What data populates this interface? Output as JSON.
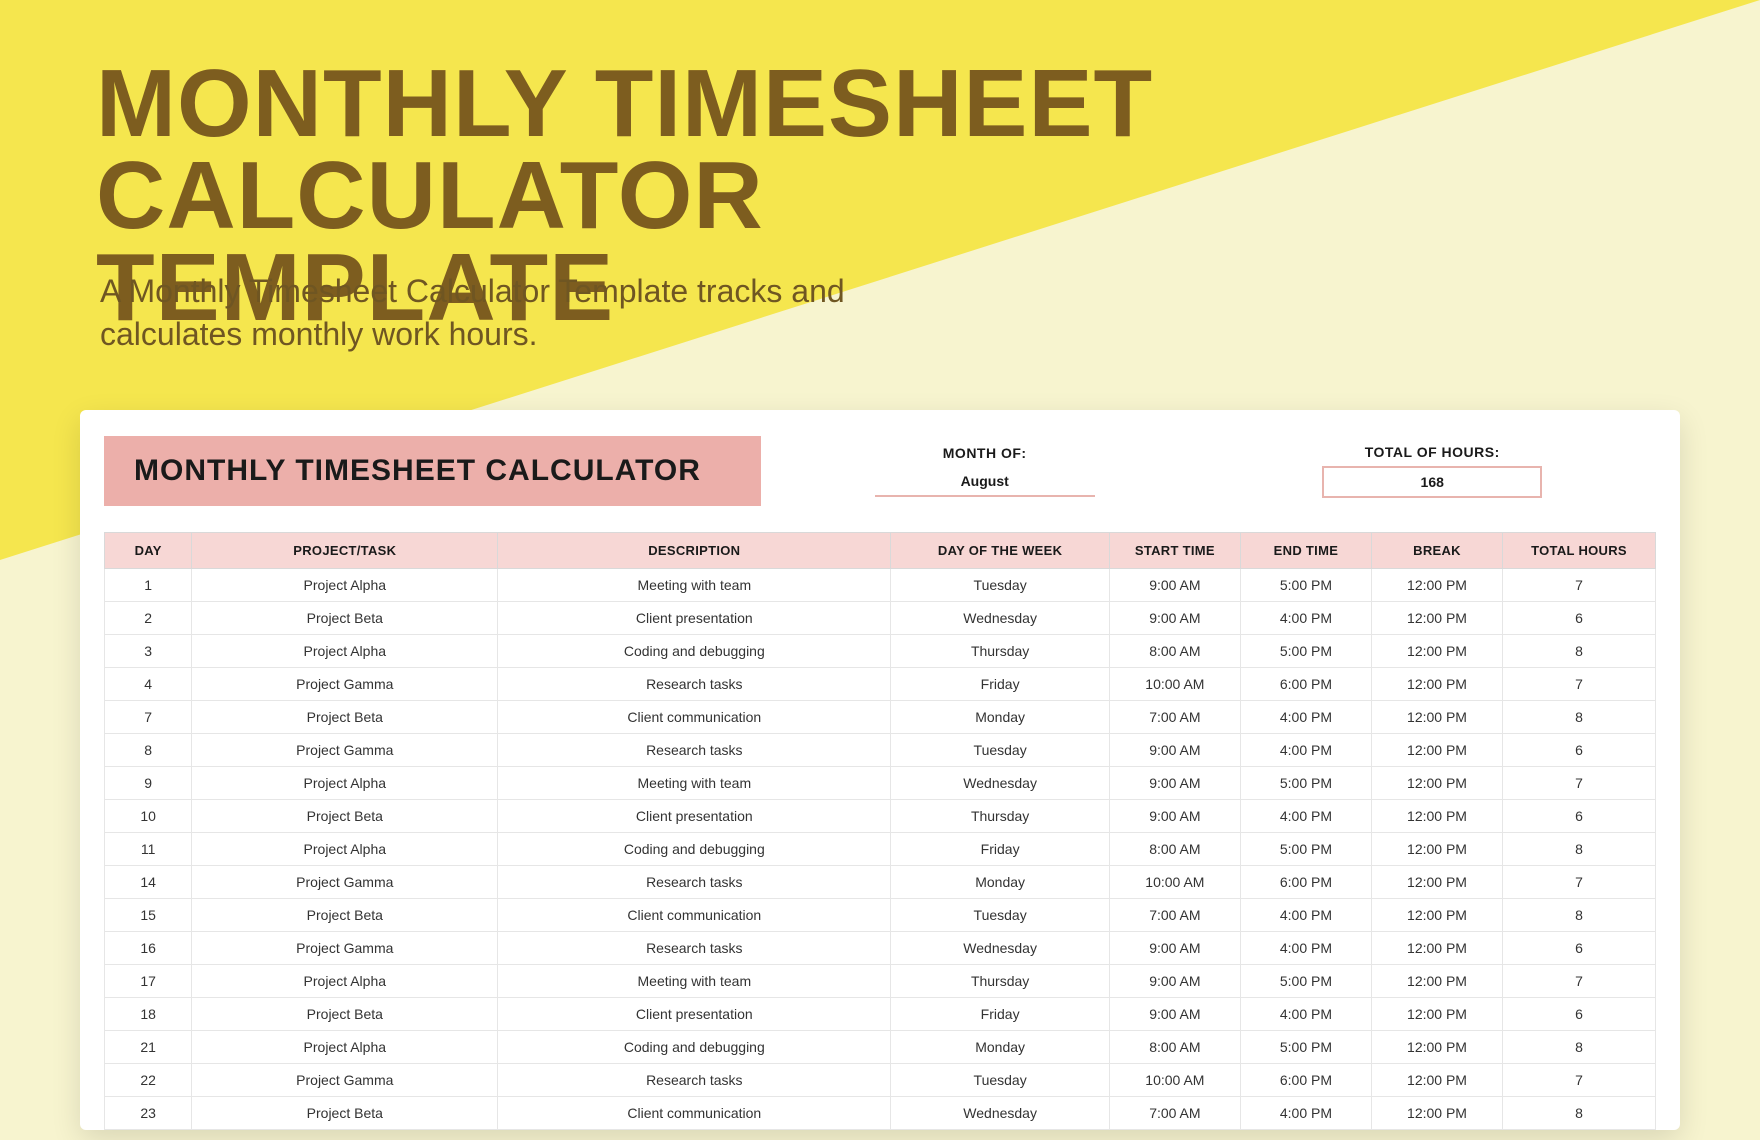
{
  "hero": {
    "title_line1": "MONTHLY TIMESHEET",
    "title_line2": "CALCULATOR TEMPLATE",
    "subtitle": "A Monthly Timesheet Calculator Template tracks and calculates monthly work hours."
  },
  "sheet": {
    "title": "MONTHLY TIMESHEET CALCULATOR",
    "month_label": "MONTH OF:",
    "month_value": "August",
    "total_label": "TOTAL OF HOURS:",
    "total_value": "168"
  },
  "columns": {
    "day": "DAY",
    "project": "PROJECT/TASK",
    "description": "DESCRIPTION",
    "dow": "DAY OF THE WEEK",
    "start": "START TIME",
    "end": "END TIME",
    "break": "BREAK",
    "total": "TOTAL HOURS"
  },
  "rows": [
    {
      "day": "1",
      "project": "Project Alpha",
      "description": "Meeting with team",
      "dow": "Tuesday",
      "start": "9:00 AM",
      "end": "5:00 PM",
      "break": "12:00 PM",
      "total": "7"
    },
    {
      "day": "2",
      "project": "Project Beta",
      "description": "Client presentation",
      "dow": "Wednesday",
      "start": "9:00 AM",
      "end": "4:00 PM",
      "break": "12:00 PM",
      "total": "6"
    },
    {
      "day": "3",
      "project": "Project Alpha",
      "description": "Coding and debugging",
      "dow": "Thursday",
      "start": "8:00 AM",
      "end": "5:00 PM",
      "break": "12:00 PM",
      "total": "8"
    },
    {
      "day": "4",
      "project": "Project Gamma",
      "description": "Research tasks",
      "dow": "Friday",
      "start": "10:00 AM",
      "end": "6:00 PM",
      "break": "12:00 PM",
      "total": "7"
    },
    {
      "day": "7",
      "project": "Project Beta",
      "description": "Client communication",
      "dow": "Monday",
      "start": "7:00 AM",
      "end": "4:00 PM",
      "break": "12:00 PM",
      "total": "8"
    },
    {
      "day": "8",
      "project": "Project Gamma",
      "description": "Research tasks",
      "dow": "Tuesday",
      "start": "9:00 AM",
      "end": "4:00 PM",
      "break": "12:00 PM",
      "total": "6"
    },
    {
      "day": "9",
      "project": "Project Alpha",
      "description": "Meeting with team",
      "dow": "Wednesday",
      "start": "9:00 AM",
      "end": "5:00 PM",
      "break": "12:00 PM",
      "total": "7"
    },
    {
      "day": "10",
      "project": "Project Beta",
      "description": "Client presentation",
      "dow": "Thursday",
      "start": "9:00 AM",
      "end": "4:00 PM",
      "break": "12:00 PM",
      "total": "6"
    },
    {
      "day": "11",
      "project": "Project Alpha",
      "description": "Coding and debugging",
      "dow": "Friday",
      "start": "8:00 AM",
      "end": "5:00 PM",
      "break": "12:00 PM",
      "total": "8"
    },
    {
      "day": "14",
      "project": "Project Gamma",
      "description": "Research tasks",
      "dow": "Monday",
      "start": "10:00 AM",
      "end": "6:00 PM",
      "break": "12:00 PM",
      "total": "7"
    },
    {
      "day": "15",
      "project": "Project Beta",
      "description": "Client communication",
      "dow": "Tuesday",
      "start": "7:00 AM",
      "end": "4:00 PM",
      "break": "12:00 PM",
      "total": "8"
    },
    {
      "day": "16",
      "project": "Project Gamma",
      "description": "Research tasks",
      "dow": "Wednesday",
      "start": "9:00 AM",
      "end": "4:00 PM",
      "break": "12:00 PM",
      "total": "6"
    },
    {
      "day": "17",
      "project": "Project Alpha",
      "description": "Meeting with team",
      "dow": "Thursday",
      "start": "9:00 AM",
      "end": "5:00 PM",
      "break": "12:00 PM",
      "total": "7"
    },
    {
      "day": "18",
      "project": "Project Beta",
      "description": "Client presentation",
      "dow": "Friday",
      "start": "9:00 AM",
      "end": "4:00 PM",
      "break": "12:00 PM",
      "total": "6"
    },
    {
      "day": "21",
      "project": "Project Alpha",
      "description": "Coding and debugging",
      "dow": "Monday",
      "start": "8:00 AM",
      "end": "5:00 PM",
      "break": "12:00 PM",
      "total": "8"
    },
    {
      "day": "22",
      "project": "Project Gamma",
      "description": "Research tasks",
      "dow": "Tuesday",
      "start": "10:00 AM",
      "end": "6:00 PM",
      "break": "12:00 PM",
      "total": "7"
    },
    {
      "day": "23",
      "project": "Project Beta",
      "description": "Client communication",
      "dow": "Wednesday",
      "start": "7:00 AM",
      "end": "4:00 PM",
      "break": "12:00 PM",
      "total": "8"
    }
  ]
}
